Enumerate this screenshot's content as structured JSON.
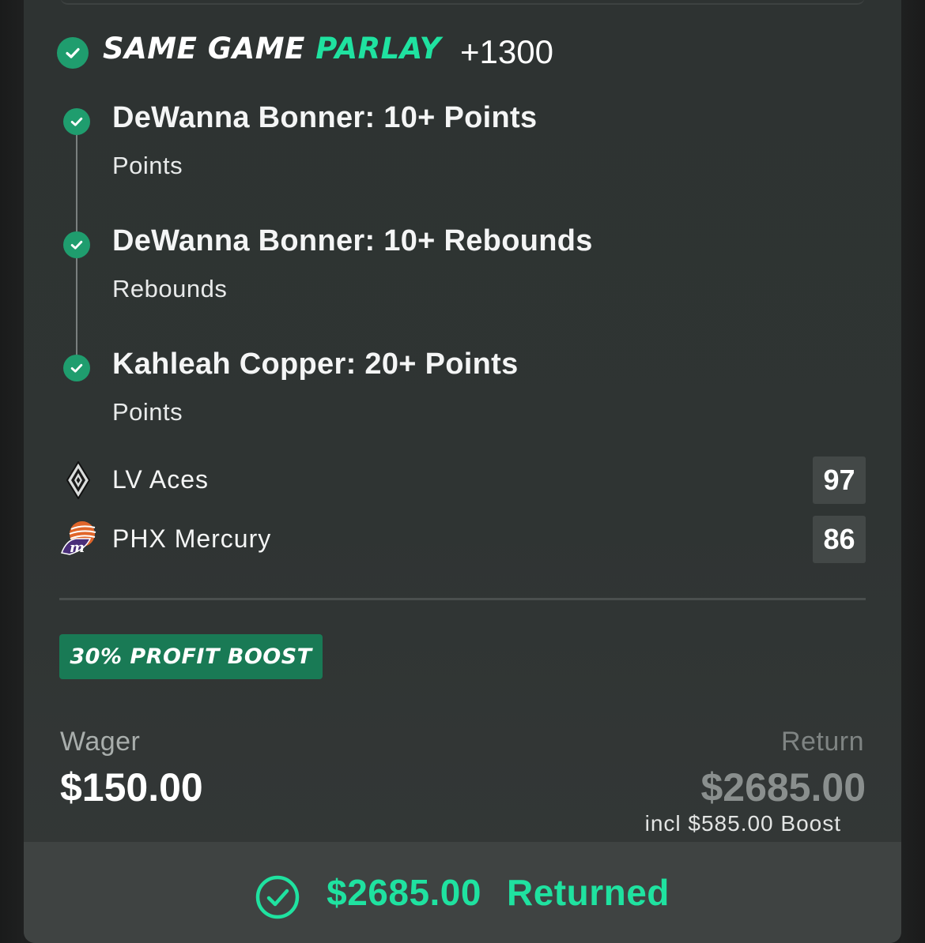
{
  "bet": {
    "type_prefix": "SAME GAME ",
    "type_accent": "PARLAY",
    "odds": "+1300"
  },
  "legs": [
    {
      "title": "DeWanna Bonner: 10+ Points",
      "market": "Points",
      "status": "won"
    },
    {
      "title": "DeWanna Bonner: 10+ Rebounds",
      "market": "Rebounds",
      "status": "won"
    },
    {
      "title": "Kahleah Copper: 20+ Points",
      "market": "Points",
      "status": "won"
    }
  ],
  "game": {
    "teams": [
      {
        "name": "LV Aces",
        "score": "97",
        "logo_icon": "lv-aces-logo-icon"
      },
      {
        "name": "PHX Mercury",
        "score": "86",
        "logo_icon": "phx-mercury-logo-icon"
      }
    ]
  },
  "promo": {
    "badge": "30% PROFIT BOOST"
  },
  "summary": {
    "wager_label": "Wager",
    "wager_value": "$150.00",
    "return_label": "Return",
    "return_value": "$2685.00",
    "boost_note": "incl $585.00 Boost"
  },
  "footer": {
    "amount": "$2685.00",
    "status": "Returned"
  },
  "colors": {
    "accent_green": "#1fe2a0",
    "check_green": "#1f9d6e",
    "badge_green": "#197a55",
    "card_bg": "#2f3433"
  }
}
